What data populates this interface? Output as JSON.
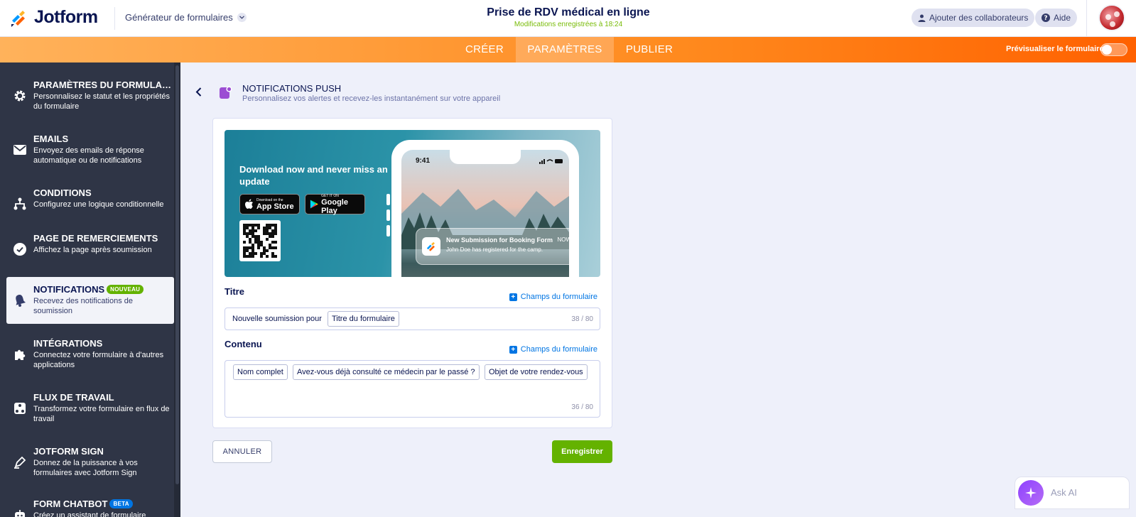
{
  "header": {
    "logo_text": "Jotform",
    "builder_label": "Générateur de formulaires",
    "form_title": "Prise de RDV médical en ligne",
    "saved_status": "Modifications enregistrées à 18:24",
    "collab_label": "Ajouter des collaborateurs",
    "help_label": "Aide"
  },
  "nav": {
    "tabs": [
      {
        "label": "CRÉER"
      },
      {
        "label": "PARAMÈTRES"
      },
      {
        "label": "PUBLIER"
      }
    ],
    "active_tab": "PARAMÈTRES",
    "preview_label": "Prévisualiser le formulaire",
    "preview_on": false
  },
  "sidebar": {
    "items": [
      {
        "title": "PARAMÈTRES DU FORMULAIRE",
        "desc": "Personnalisez le statut et les propriétés du formulaire",
        "icon": "gear-icon"
      },
      {
        "title": "EMAILS",
        "desc": "Envoyez des emails de réponse automatique ou de notifications",
        "icon": "envelope-icon"
      },
      {
        "title": "CONDITIONS",
        "desc": "Configurez une logique conditionnelle",
        "icon": "flow-icon"
      },
      {
        "title": "PAGE DE REMERCIEMENTS",
        "desc": "Affichez la page après soumission",
        "icon": "check-circle-icon"
      },
      {
        "title": "NOTIFICATIONS",
        "badge": "NOUVEAU",
        "desc": "Recevez des notifications de soumission",
        "icon": "bell-icon",
        "active": true
      },
      {
        "title": "INTÉGRATIONS",
        "desc": "Connectez votre formulaire à d'autres applications",
        "icon": "puzzle-icon"
      },
      {
        "title": "FLUX DE TRAVAIL",
        "desc": "Transformez votre formulaire en flux de travail",
        "icon": "workflow-icon"
      },
      {
        "title": "JOTFORM SIGN",
        "desc": "Donnez de la puissance à vos formulaires avec Jotform Sign",
        "icon": "pen-icon"
      },
      {
        "title": "FORM CHATBOT",
        "badge": "BETA",
        "desc": "Créez un assistant de formulaire",
        "icon": "chatbot-icon"
      }
    ]
  },
  "page": {
    "title": "NOTIFICATIONS PUSH",
    "subtitle": "Personnalisez vos alertes et recevez-les instantanément sur votre appareil"
  },
  "banner": {
    "headline": "Download now and never miss an update",
    "appstore_small": "Download on the",
    "appstore_big": "App Store",
    "google_small": "GET IT ON",
    "google_big": "Google Play",
    "phone_time": "9:41",
    "notif_title": "New Submission for Booking Form",
    "notif_time": "NOW",
    "notif_body": "John Doe has registered for the camp."
  },
  "title_field": {
    "label": "Titre",
    "form_fields_link": "Champs du formulaire",
    "prefix_text": "Nouvelle soumission pour",
    "tags": [
      "Titre du formulaire"
    ],
    "counter": "38 / 80"
  },
  "content_field": {
    "label": "Contenu",
    "form_fields_link": "Champs du formulaire",
    "tags": [
      "Nom complet",
      "Avez-vous déjà consulté ce médecin par le passé ?",
      "Objet de votre rendez-vous"
    ],
    "counter": "36 / 80"
  },
  "actions": {
    "cancel_label": "ANNULER",
    "save_label": "Enregistrer"
  },
  "ask_ai": {
    "label": "Ask AI"
  },
  "colors": {
    "brand_orange": "#ff6100",
    "save_green": "#64b200",
    "link_blue": "#0075e3",
    "sidebar_bg": "#2f3546"
  }
}
